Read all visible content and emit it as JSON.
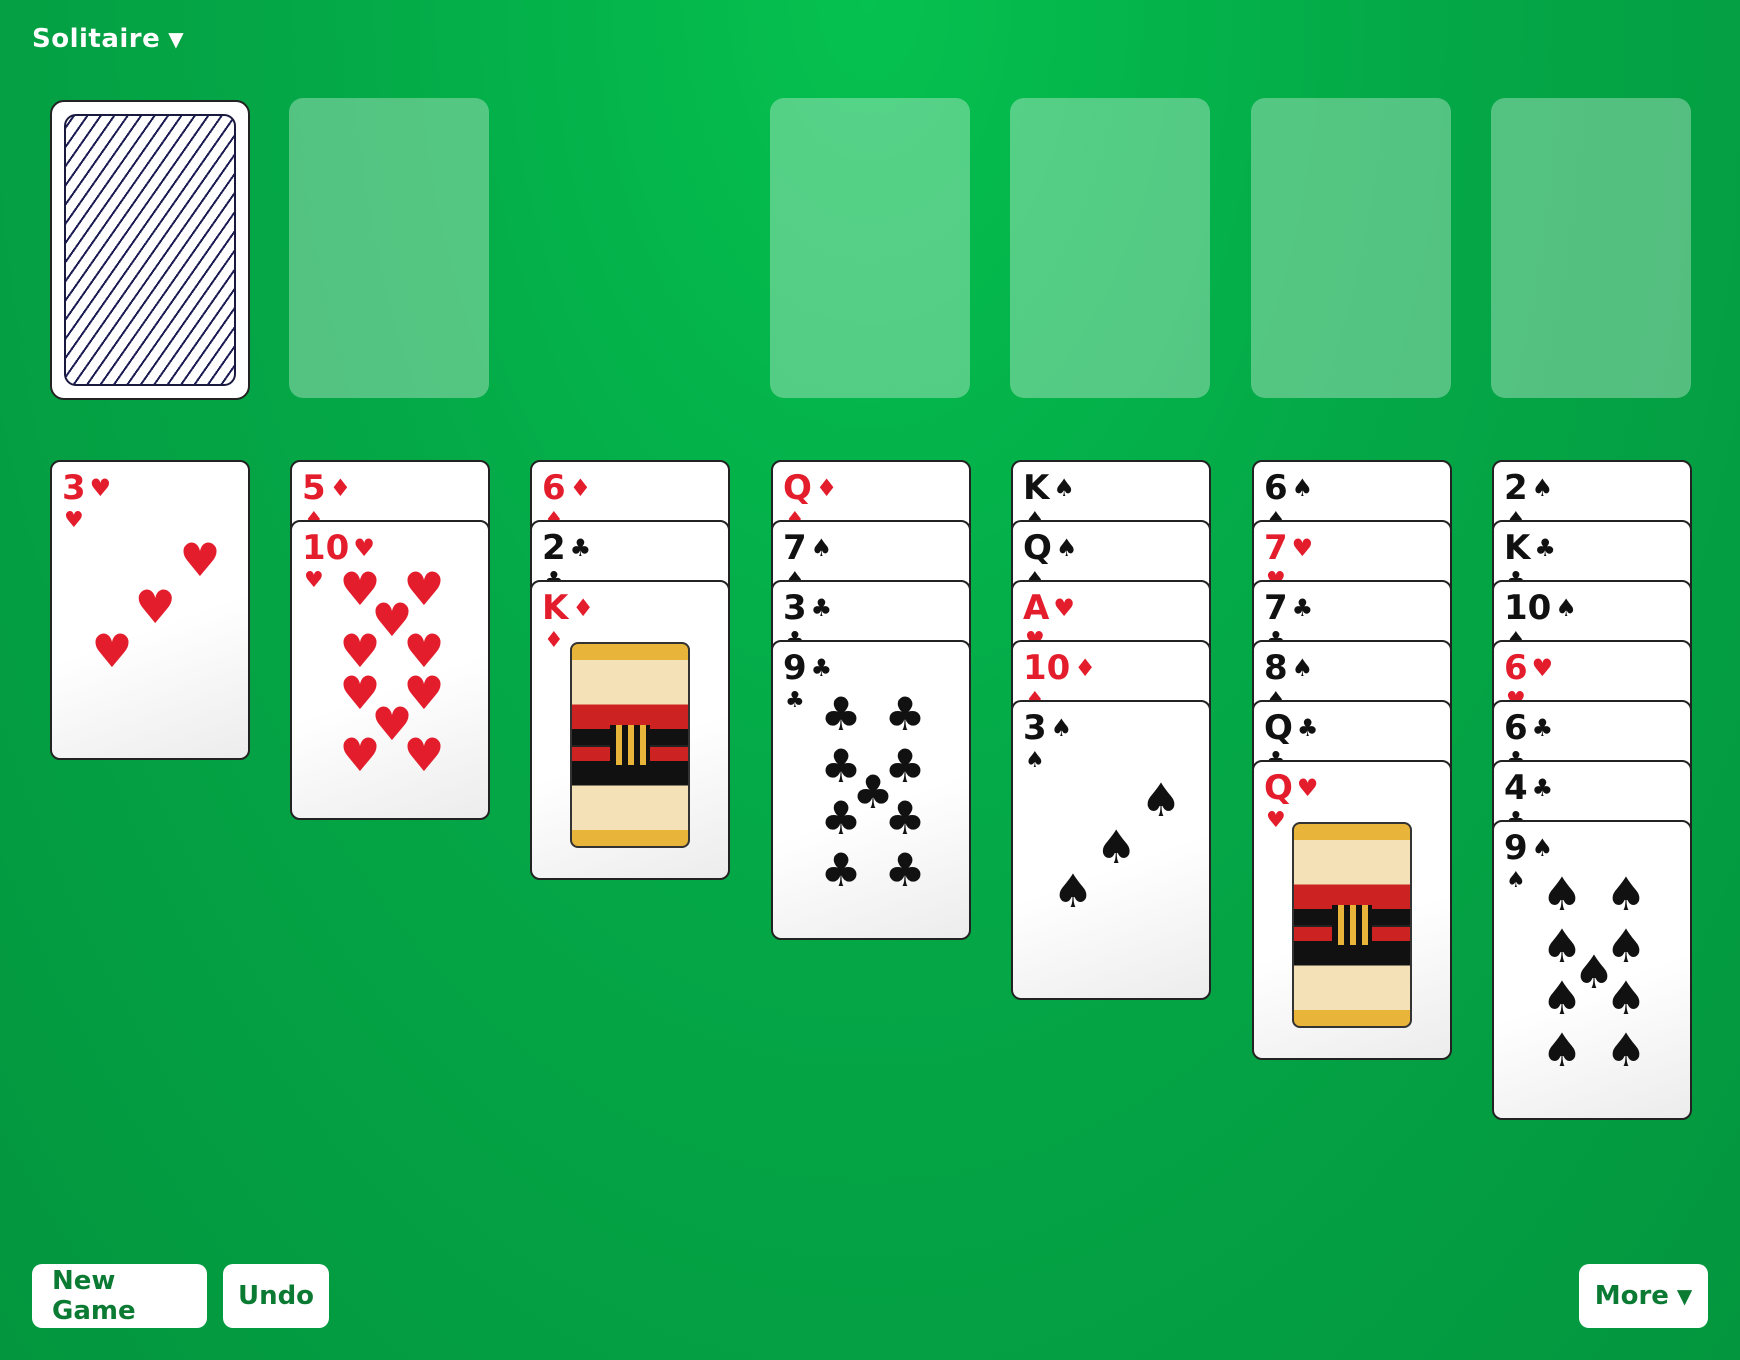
{
  "menu": {
    "title": "Solitaire",
    "arrow": "▼"
  },
  "buttons": {
    "new_game": "New Game",
    "undo": "Undo",
    "more": "More",
    "more_arrow": "▼"
  },
  "colors": {
    "felt": "#04a847",
    "button_text": "#0b7a33",
    "red_suit": "#e41d2d"
  },
  "stock": {
    "face": "down",
    "pattern": "diagonal-stripes"
  },
  "waste": {
    "cards": []
  },
  "foundations": [
    {
      "cards": []
    },
    {
      "cards": []
    },
    {
      "cards": []
    },
    {
      "cards": []
    }
  ],
  "tableau": [
    [
      {
        "rank": "3",
        "suit": "♥"
      }
    ],
    [
      {
        "rank": "5",
        "suit": "♦"
      },
      {
        "rank": "10",
        "suit": "♥"
      }
    ],
    [
      {
        "rank": "6",
        "suit": "♦"
      },
      {
        "rank": "2",
        "suit": "♣"
      },
      {
        "rank": "K",
        "suit": "♦"
      }
    ],
    [
      {
        "rank": "Q",
        "suit": "♦"
      },
      {
        "rank": "7",
        "suit": "♠"
      },
      {
        "rank": "3",
        "suit": "♣"
      },
      {
        "rank": "9",
        "suit": "♣"
      }
    ],
    [
      {
        "rank": "K",
        "suit": "♠"
      },
      {
        "rank": "Q",
        "suit": "♠"
      },
      {
        "rank": "A",
        "suit": "♥"
      },
      {
        "rank": "10",
        "suit": "♦"
      },
      {
        "rank": "3",
        "suit": "♠"
      }
    ],
    [
      {
        "rank": "6",
        "suit": "♠"
      },
      {
        "rank": "7",
        "suit": "♥"
      },
      {
        "rank": "7",
        "suit": "♣"
      },
      {
        "rank": "8",
        "suit": "♠"
      },
      {
        "rank": "Q",
        "suit": "♣"
      },
      {
        "rank": "Q",
        "suit": "♥"
      }
    ],
    [
      {
        "rank": "2",
        "suit": "♠"
      },
      {
        "rank": "K",
        "suit": "♣"
      },
      {
        "rank": "10",
        "suit": "♠"
      },
      {
        "rank": "6",
        "suit": "♥"
      },
      {
        "rank": "6",
        "suit": "♣"
      },
      {
        "rank": "4",
        "suit": "♣"
      },
      {
        "rank": "9",
        "suit": "♠"
      }
    ]
  ]
}
